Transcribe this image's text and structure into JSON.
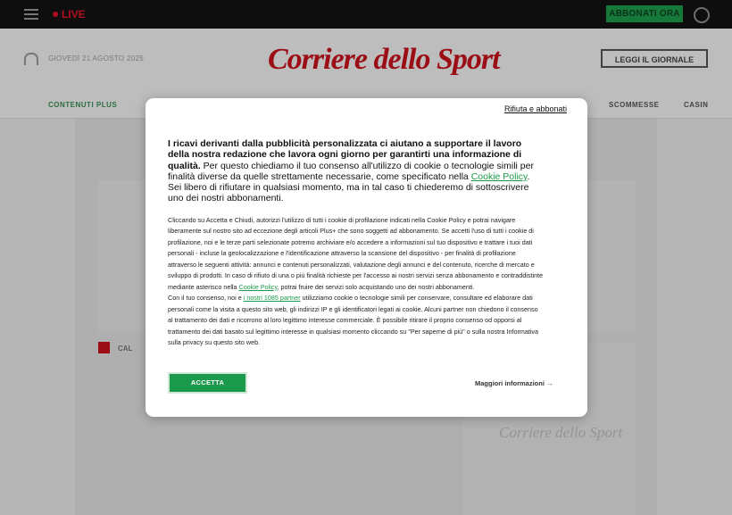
{
  "topbar": {
    "live_label": "LIVE",
    "subscribe_label": "ABBONATI ORA"
  },
  "header": {
    "date": "GIOVEDÌ 21 AGOSTO 2025",
    "logo_text": "Corriere dello Sport",
    "read_button_label": "LEGGI IL GIORNALE"
  },
  "nav": {
    "left_item": "CONTENUTI PLUS",
    "right_items": [
      "SCOMMESSE",
      "CASIN"
    ]
  },
  "content": {
    "breadcrumb": "CAL",
    "sidebar_logo": "Corriere dello Sport"
  },
  "modal": {
    "reject_link": "Rifiuta e abbonati",
    "lead_bold": "I ricavi derivanti dalla pubblicità personalizzata ci aiutano a supportare il lavoro della nostra redazione che lavora ogni giorno per garantirti una informazione di qualità.",
    "lead_text_1": " Per questo chiediamo il tuo consenso all'utilizzo di cookie o tecnologie simili per finalità diverse da quelle strettamente necessarie, come specificato nella ",
    "lead_link": "Cookie Policy",
    "lead_text_2": ". Sei libero di rifiutare in qualsiasi momento, ma in tal caso ti chiederemo di sottoscrivere uno dei nostri abbonamenti.",
    "p1_text_1": "Cliccando su Accetta e Chiudi, autorizzi l'utilizzo di tutti i cookie di profilazione indicati nella Cookie Policy e potrai navigare liberamente sul nostro sito ad eccezione degli articoli Plus+ che sono soggetti ad abbonamento. Se accetti l'uso di tutti i cookie di profilazione, noi e le terze parti selezionate potremo archiviare e/o accedere a informazioni sul tuo dispositivo e trattare i tuoi dati personali - incluse la geolocalizzazione e l'identificazione attraverso la scansione del dispositivo - per finalità di profilazione attraverso le seguenti attività: annunci e contenuti personalizzati, valutazione degli annunci e del contenuto, ricerche di mercato e sviluppo di prodotti. In caso di rifiuto di una o più finalità richieste per l'accesso ai nostri servizi senza abbonamento e contraddistinte mediante asterisco nella ",
    "p1_link": "Cookie Policy",
    "p1_text_2": ", potrai fruire dei servizi solo acquistando uno dei nostri abbonamenti.",
    "p2_text_1": "Con il tuo consenso, noi e ",
    "p2_link": "i nostri 1085 partner",
    "p2_text_2": " utilizziamo cookie o tecnologie simili per conservare, consultare ed elaborare dati personali come la visita a questo sito web, gli indirizzi IP e gli identificatori legati ai cookie. Alcuni partner non chiedono il consenso al trattamento dei dati e ricorrono al loro legittimo interesse commerciale. È possibile ritirare il proprio consenso od opporsi al trattamento dei dati basato sul legittimo interesse in qualsiasi momento cliccando su \"Per saperne di più\" o sulla nostra Informativa sulla privacy su questo sito web.",
    "accept_label": "ACCETTA",
    "more_info_label": "Maggiori informazioni →"
  }
}
